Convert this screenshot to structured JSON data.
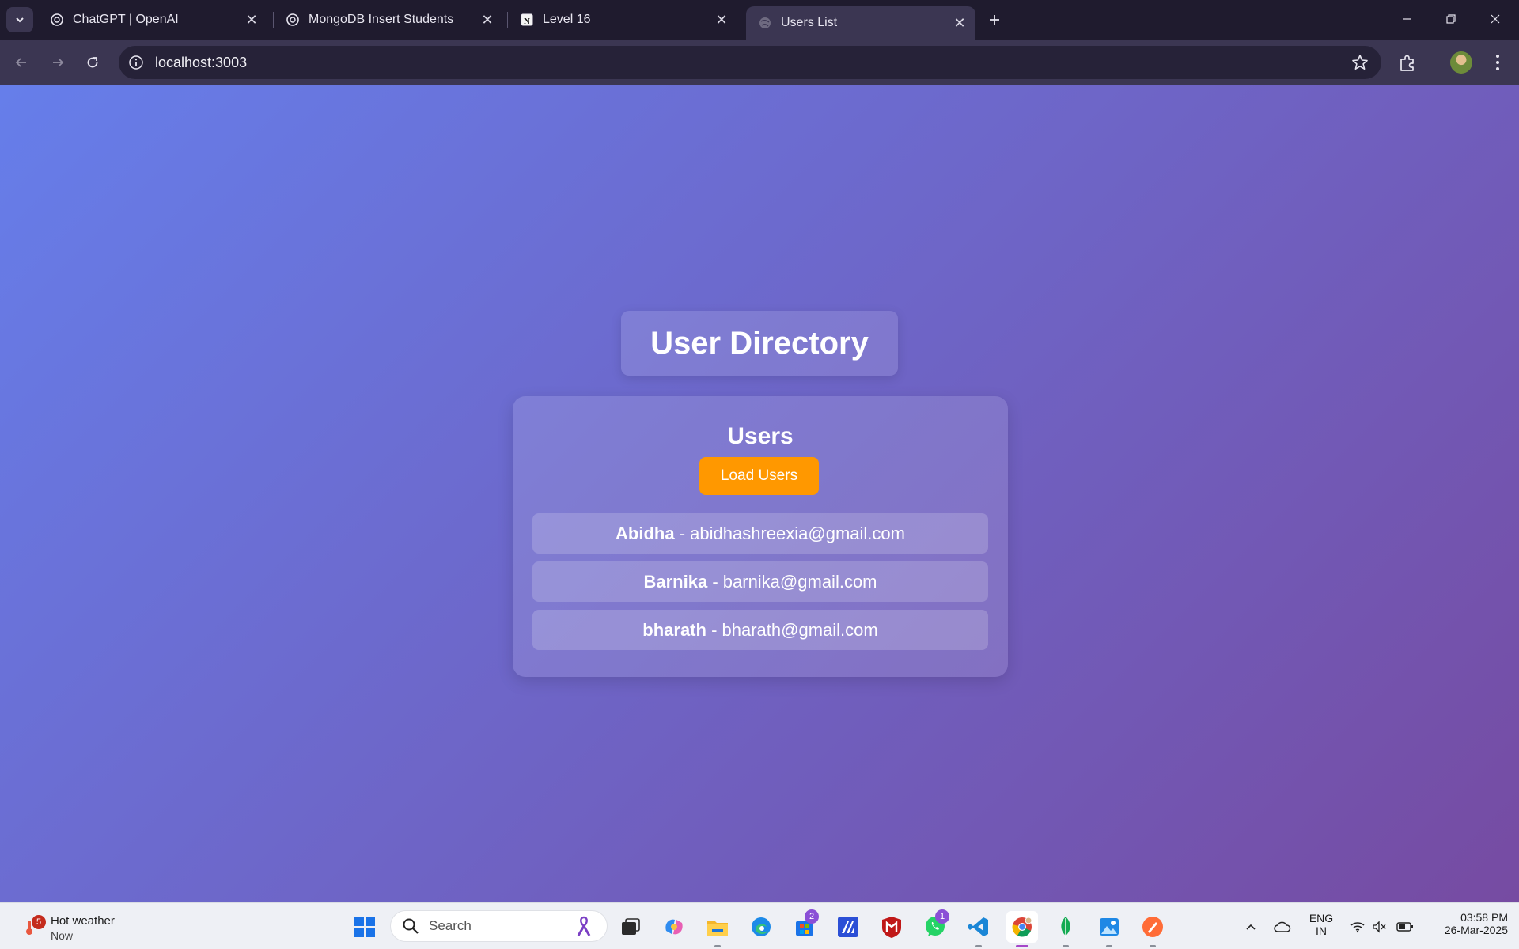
{
  "browser": {
    "tabs": [
      {
        "title": "ChatGPT | OpenAI",
        "icon": "openai-icon",
        "active": false
      },
      {
        "title": "MongoDB Insert Students",
        "icon": "openai-icon",
        "active": false
      },
      {
        "title": "Level 16",
        "icon": "notion-icon",
        "active": false
      },
      {
        "title": "Users List",
        "icon": "globe-icon",
        "active": true
      }
    ],
    "url": "localhost:3003"
  },
  "page": {
    "title": "User Directory",
    "section_heading": "Users",
    "load_button_label": "Load Users",
    "button_color": "#ff9800",
    "users": [
      {
        "name": "Abidha",
        "separator": " - ",
        "email": "abidhashreexia@gmail.com"
      },
      {
        "name": "Barnika",
        "separator": " - ",
        "email": "barnika@gmail.com"
      },
      {
        "name": "bharath",
        "separator": " - ",
        "email": "bharath@gmail.com"
      }
    ]
  },
  "taskbar": {
    "weather": {
      "title": "Hot weather",
      "subtitle": "Now",
      "badge": "5"
    },
    "search_placeholder": "Search",
    "store_badge": "2",
    "whatsapp_badge": "1",
    "language": "ENG",
    "region": "IN",
    "time": "03:58 PM",
    "date": "26-Mar-2025"
  }
}
